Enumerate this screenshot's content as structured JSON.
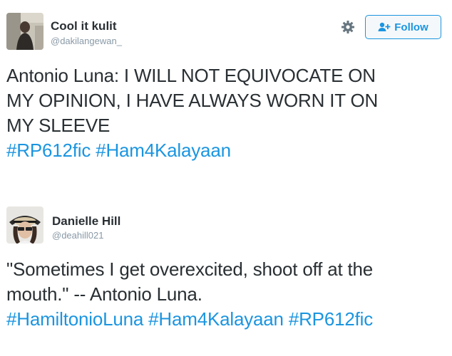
{
  "tweets": [
    {
      "name": "Cool it kulit",
      "handle": "@dakilangewan_",
      "follow_label": "Follow",
      "text_lines": [
        "Antonio Luna: I WILL NOT EQUIVOCATE ON",
        "MY OPINION, I HAVE ALWAYS WORN IT ON",
        "MY SLEEVE"
      ],
      "hashtags": [
        "#RP612fic",
        "#Ham4Kalayaan"
      ],
      "icons": {
        "settings": "gear-icon",
        "follow": "add-user-icon"
      }
    },
    {
      "name": "Danielle Hill",
      "handle": "@deahill021",
      "text_lines": [
        "\"Sometimes I get overexcited, shoot off at the",
        "mouth.\" -- Antonio Luna."
      ],
      "hashtags": [
        "#HamiltonioLuna",
        "#Ham4Kalayaan",
        "#RP612fic"
      ]
    }
  ],
  "colors": {
    "link": "#1b95e0",
    "text": "#292f33",
    "muted": "#8899a6"
  }
}
